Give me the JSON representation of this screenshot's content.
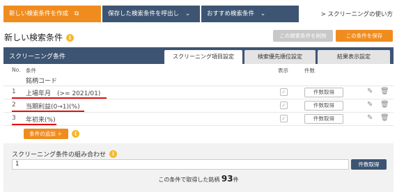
{
  "nav": {
    "new_tab": "新しい検索条件を作成",
    "saved_tab": "保存した検索条件を呼出し",
    "recommend_tab": "おすすめ検索条件",
    "howto": "> スクリーニングの使い方"
  },
  "header": {
    "title": "新しい検索条件",
    "delete_button": "この検索条件を削除",
    "save_button": "この条件を保存"
  },
  "panel": {
    "title": "スクリーニング条件",
    "tabs": [
      "スクリーニング項目設定",
      "検索優先順位設定",
      "結果表示設定"
    ],
    "col_no": "No.",
    "col_cond": "条件",
    "col_show": "表示",
    "col_count": "件数",
    "base_condition": "銘柄コード",
    "rows": [
      {
        "no": "1",
        "cond": "上場年月　(>= 2021/01)",
        "count_button": "件数取得"
      },
      {
        "no": "2",
        "cond": "当期利益(0→1)(%)",
        "count_button": "件数取得"
      },
      {
        "no": "3",
        "cond": "年初来(%)",
        "count_button": "件数取得"
      }
    ],
    "add_button": "条件の追加 ＋"
  },
  "combo": {
    "label": "スクリーニング条件の組み合わせ",
    "value": "1",
    "button": "件数取得",
    "result_prefix": "この条件で取得した銘柄",
    "result_count": "93",
    "result_suffix": "件"
  },
  "colors": {
    "orange": "#f08c1e",
    "navy": "#3d5573",
    "underline": "#dd1111"
  }
}
